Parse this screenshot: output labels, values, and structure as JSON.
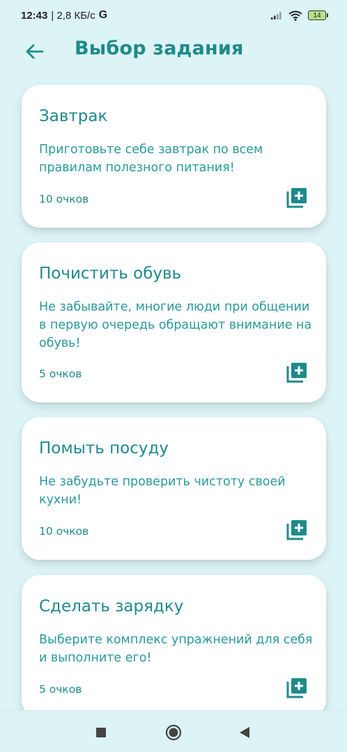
{
  "status_bar": {
    "time": "12:43",
    "network_speed": "| 2,8 КБ/с",
    "g_icon": "G",
    "battery_level": "14",
    "icons": [
      "signal-icon",
      "wifi-icon",
      "battery-icon"
    ]
  },
  "header": {
    "title": "Выбор задания",
    "back_icon": "arrow-left-icon"
  },
  "tasks": [
    {
      "title": "Завтрак",
      "description": "Приготовьте себе завтрак по всем правилам полезного питания!",
      "points": "10 очков"
    },
    {
      "title": "Почистить обувь",
      "description": "Не забывайте, многие люди при общении в первую очередь обращают внимание на обувь!",
      "points": "5 очков"
    },
    {
      "title": "Помыть посуду",
      "description": "Не забудьте проверить чистоту своей кухни!",
      "points": "10 очков"
    },
    {
      "title": "Сделать зарядку",
      "description": "Выберите комплекс упражнений для себя и выполните его!",
      "points": "5 очков"
    }
  ],
  "colors": {
    "background": "#dcf4f6",
    "accent": "#1f8a8a",
    "card": "#ffffff"
  },
  "nav_bar": {
    "icons": [
      "recent-apps-icon",
      "home-icon",
      "back-triangle-icon"
    ]
  }
}
